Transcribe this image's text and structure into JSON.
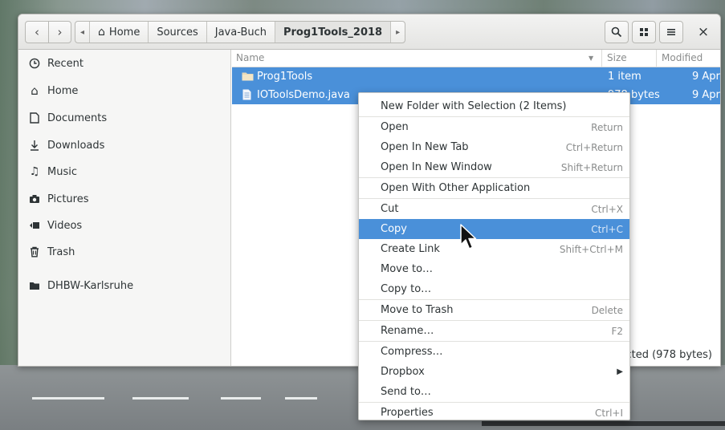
{
  "nav": {
    "back_glyph": "‹",
    "forward_glyph": "›",
    "path_left_glyph": "◂",
    "path_right_glyph": "▸"
  },
  "breadcrumb": [
    {
      "label": "Home",
      "icon": "home-icon"
    },
    {
      "label": "Sources"
    },
    {
      "label": "Java-Buch"
    },
    {
      "label": "Prog1Tools_2018",
      "current": true
    }
  ],
  "toolbar": {
    "search_icon": "search-icon",
    "view_grid_icon": "grid-icon",
    "menu_icon": "hamburger-icon",
    "close_glyph": "×"
  },
  "sidebar": {
    "items": [
      {
        "label": "Recent",
        "icon": "clock-icon"
      },
      {
        "label": "Home",
        "icon": "home-icon"
      },
      {
        "label": "Documents",
        "icon": "document-icon"
      },
      {
        "label": "Downloads",
        "icon": "download-icon"
      },
      {
        "label": "Music",
        "icon": "music-icon"
      },
      {
        "label": "Pictures",
        "icon": "camera-icon"
      },
      {
        "label": "Videos",
        "icon": "video-icon"
      },
      {
        "label": "Trash",
        "icon": "trash-icon"
      },
      {
        "label": "DHBW-Karlsruhe",
        "icon": "folder-icon"
      }
    ]
  },
  "columns": {
    "name": "Name",
    "size": "Size",
    "modified": "Modified"
  },
  "files": [
    {
      "name": "Prog1Tools",
      "size": "1 item",
      "modified": "9 Apr",
      "icon": "folder-icon"
    },
    {
      "name": "IOToolsDemo.java",
      "size": "978 bytes",
      "modified": "9 Apr",
      "icon": "file-icon"
    }
  ],
  "status_text": "ected (978 bytes)",
  "context_menu": {
    "items": [
      {
        "label": "New Folder with Selection (2 Items)",
        "shortcut": ""
      },
      {
        "sep": true
      },
      {
        "label": "Open",
        "shortcut": "Return"
      },
      {
        "label": "Open In New Tab",
        "shortcut": "Ctrl+Return"
      },
      {
        "label": "Open In New Window",
        "shortcut": "Shift+Return"
      },
      {
        "sep": true
      },
      {
        "label": "Open With Other Application",
        "shortcut": ""
      },
      {
        "sep": true
      },
      {
        "label": "Cut",
        "shortcut": "Ctrl+X"
      },
      {
        "label": "Copy",
        "shortcut": "Ctrl+C",
        "highlight": true
      },
      {
        "label": "Create Link",
        "shortcut": "Shift+Ctrl+M"
      },
      {
        "label": "Move to…",
        "shortcut": ""
      },
      {
        "label": "Copy to…",
        "shortcut": ""
      },
      {
        "sep": true
      },
      {
        "label": "Move to Trash",
        "shortcut": "Delete"
      },
      {
        "sep": true
      },
      {
        "label": "Rename…",
        "shortcut": "F2"
      },
      {
        "sep": true
      },
      {
        "label": "Compress…",
        "shortcut": ""
      },
      {
        "label": "Dropbox",
        "shortcut": "",
        "submenu": true
      },
      {
        "label": "Send to…",
        "shortcut": ""
      },
      {
        "sep": true
      },
      {
        "label": "Properties",
        "shortcut": "Ctrl+I"
      }
    ]
  },
  "colors": {
    "selection": "#4a90d9",
    "sidebar_bg": "#f6f6f5",
    "headerbar_bg": "#e8e8e7"
  }
}
